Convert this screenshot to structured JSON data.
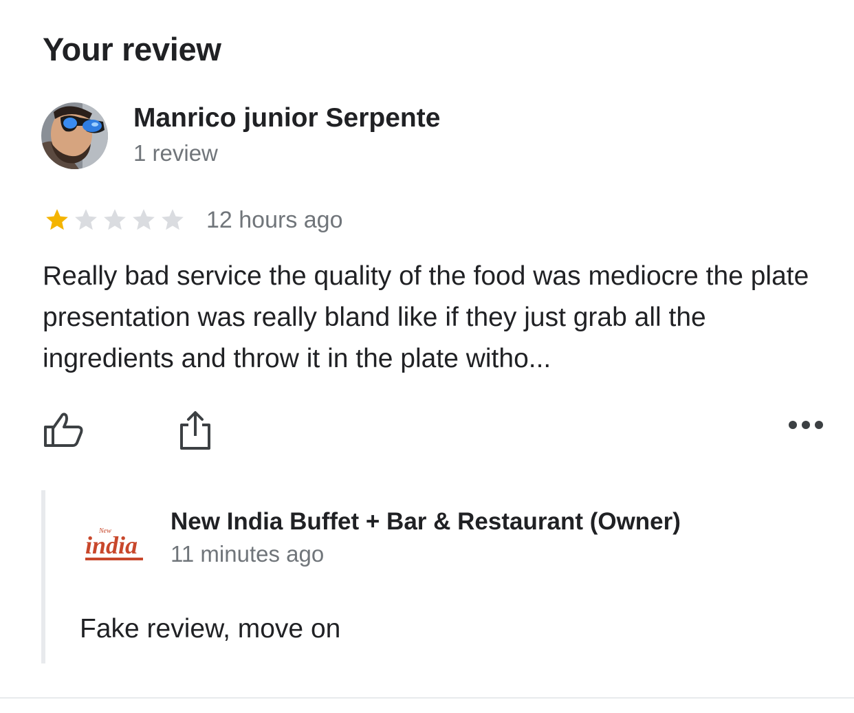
{
  "section": {
    "title": "Your review"
  },
  "review": {
    "author_name": "Manrico junior Serpente",
    "author_meta": "1 review",
    "rating": 1,
    "rating_max": 5,
    "time_ago": "12 hours ago",
    "text": "Really bad service the quality of the food was mediocre the plate presentation was really bland like if they just grab all the ingredients and throw it in the plate witho..."
  },
  "actions": {
    "like_icon": "thumbs-up-icon",
    "share_icon": "share-icon",
    "more_icon": "more-horizontal-icon"
  },
  "owner_reply": {
    "name": "New India Buffet + Bar & Restaurant (Owner)",
    "time_ago": "11 minutes ago",
    "text": "Fake review, move on",
    "logo_text": "india",
    "logo_small_text": "New"
  },
  "colors": {
    "star_filled": "#f4b400",
    "star_empty": "#dadce0",
    "secondary_text": "#70757a",
    "primary_text": "#202124",
    "logo_red": "#c8472b"
  }
}
